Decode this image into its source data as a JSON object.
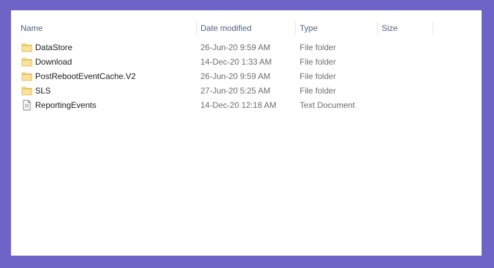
{
  "columns": {
    "name": "Name",
    "date_modified": "Date modified",
    "type": "Type",
    "size": "Size"
  },
  "files": [
    {
      "name": "DataStore",
      "date": "26-Jun-20 9:59 AM",
      "type": "File folder",
      "icon": "folder-icon"
    },
    {
      "name": "Download",
      "date": "14-Dec-20 1:33 AM",
      "type": "File folder",
      "icon": "folder-icon"
    },
    {
      "name": "PostRebootEventCache.V2",
      "date": "26-Jun-20 9:59 AM",
      "type": "File folder",
      "icon": "folder-icon"
    },
    {
      "name": "SLS",
      "date": "27-Jun-20 5:25 AM",
      "type": "File folder",
      "icon": "folder-icon"
    },
    {
      "name": "ReportingEvents",
      "date": "14-Dec-20 12:18 AM",
      "type": "Text Document",
      "icon": "text-document-icon"
    }
  ],
  "colors": {
    "background": "#6e63c6",
    "folder": "#f8d775",
    "header_text": "#4d6082"
  }
}
